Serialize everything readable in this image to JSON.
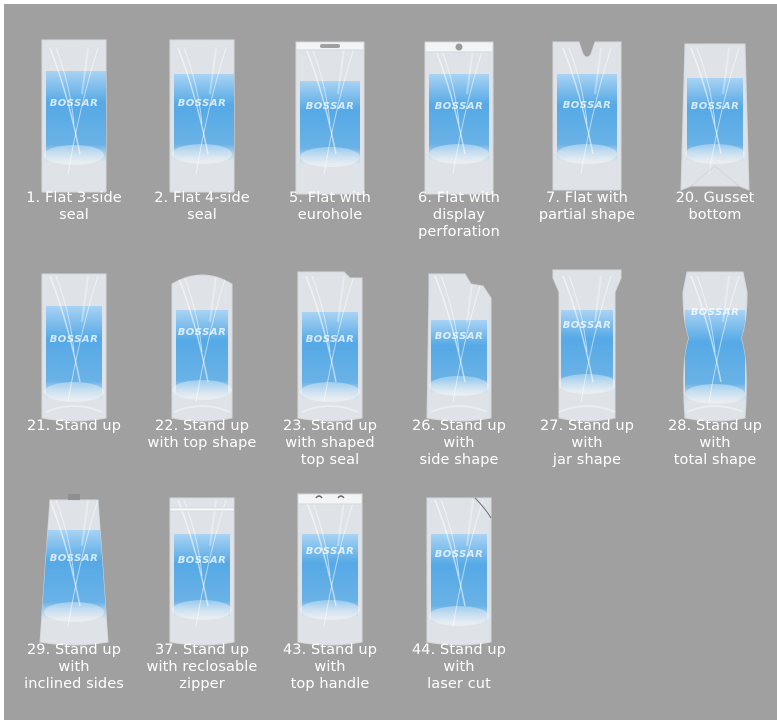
{
  "brand": "BOSSAR",
  "colors": {
    "panel": "#a0a0a0",
    "film": "#e6eaee",
    "fill_top": "#a9d3f3",
    "fill_mid": "#55a9e6",
    "caption": "#ffffff"
  },
  "bags": [
    {
      "id": "1",
      "shape": "flat-3-side",
      "label": "1. Flat 3-side\nseal"
    },
    {
      "id": "2",
      "shape": "flat-4-side",
      "label": "2. Flat 4-side\nseal"
    },
    {
      "id": "5",
      "shape": "eurohole",
      "label": "5. Flat with\neurohole"
    },
    {
      "id": "6",
      "shape": "display-perforation",
      "label": "6. Flat with\ndisplay\nperforation"
    },
    {
      "id": "7",
      "shape": "partial-shape",
      "label": "7. Flat with\npartial shape"
    },
    {
      "id": "20",
      "shape": "gusset-bottom",
      "label": "20. Gusset\nbottom"
    },
    {
      "id": "21",
      "shape": "stand-up",
      "label": "21. Stand up"
    },
    {
      "id": "22",
      "shape": "stand-up-top-shape",
      "label": "22. Stand up\nwith top shape"
    },
    {
      "id": "23",
      "shape": "stand-up-shaped-top-seal",
      "label": "23. Stand up\nwith shaped\ntop seal"
    },
    {
      "id": "26",
      "shape": "stand-up-side-shape",
      "label": "26. Stand up\nwith\nside shape"
    },
    {
      "id": "27",
      "shape": "stand-up-jar-shape",
      "label": "27. Stand up\nwith\njar shape"
    },
    {
      "id": "28",
      "shape": "stand-up-total-shape",
      "label": "28. Stand up\nwith\ntotal shape"
    },
    {
      "id": "29",
      "shape": "stand-up-inclined-sides",
      "label": "29. Stand up\nwith\ninclined sides"
    },
    {
      "id": "37",
      "shape": "stand-up-reclosable-zipper",
      "label": "37. Stand up\nwith reclosable\nzipper"
    },
    {
      "id": "43",
      "shape": "stand-up-top-handle",
      "label": "43. Stand up\nwith\ntop handle"
    },
    {
      "id": "44",
      "shape": "stand-up-laser-cut",
      "label": "44. Stand up\nwith\nlaser cut"
    }
  ]
}
